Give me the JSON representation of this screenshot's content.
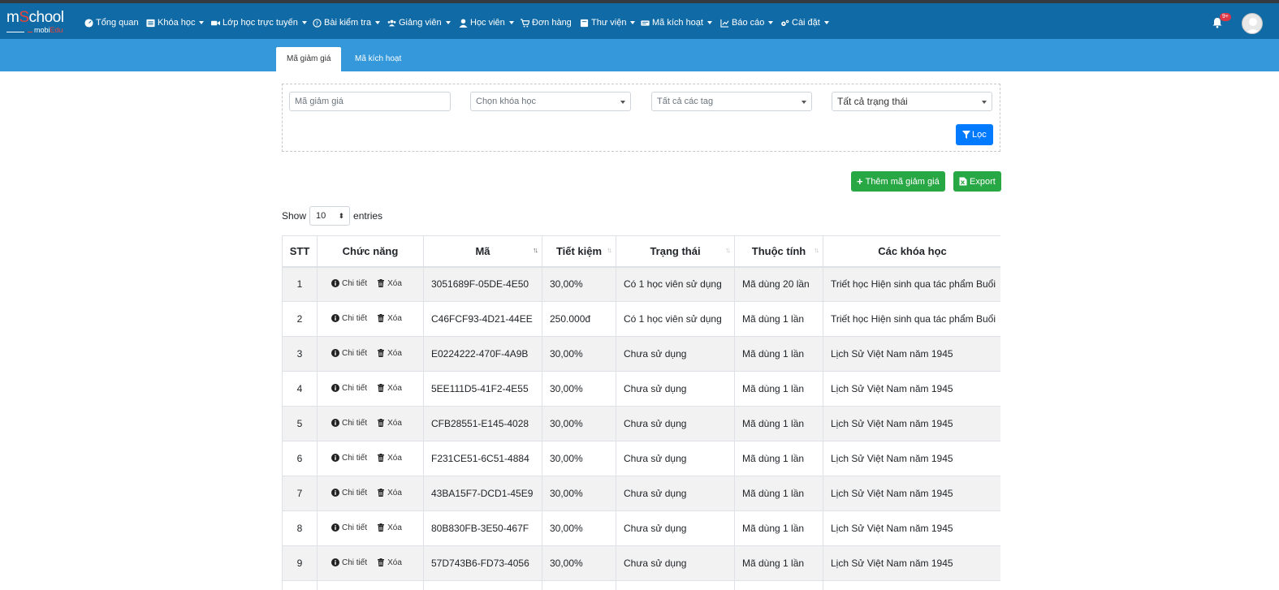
{
  "brand": {
    "logo_main": "m",
    "logo_accent": "S",
    "logo_rest": "chool",
    "logo_sub": "mobi",
    "logo_sub_accent": "Edu"
  },
  "nav": [
    {
      "label": "Tổng quan",
      "icon": "dashboard-icon",
      "caret": false
    },
    {
      "label": "Khóa học",
      "icon": "list-icon",
      "caret": true
    },
    {
      "label": "Lớp học trực tuyến",
      "icon": "video-icon",
      "caret": true
    },
    {
      "label": "Bài kiểm tra",
      "icon": "question-icon",
      "caret": true
    },
    {
      "label": "Giảng viên",
      "icon": "users-icon",
      "caret": true
    },
    {
      "label": "Học viên",
      "icon": "user-icon",
      "caret": true
    },
    {
      "label": "Đơn hàng",
      "icon": "cart-icon",
      "caret": false
    },
    {
      "label": "Thư viện",
      "icon": "book-icon",
      "caret": true
    },
    {
      "label": "Mã kích hoạt",
      "icon": "ticket-icon",
      "caret": true
    },
    {
      "label": "Báo cáo",
      "icon": "chart-icon",
      "caret": true
    },
    {
      "label": "Cài đặt",
      "icon": "cogs-icon",
      "caret": true
    }
  ],
  "notifications": {
    "badge": "9+"
  },
  "tabs": [
    {
      "label": "Mã giảm giá",
      "active": true
    },
    {
      "label": "Mã kích hoạt",
      "active": false
    }
  ],
  "filter": {
    "code_placeholder": "Mã giảm giá",
    "course_select": "Chọn khóa học",
    "tag_select": "Tất cả các tag",
    "status_select": "Tất cả trạng thái",
    "filter_button": "Lọc"
  },
  "actions": {
    "add_label": "Thêm mã giảm giá",
    "export_label": "Export"
  },
  "length": {
    "show": "Show",
    "value": "10",
    "entries": "entries"
  },
  "table": {
    "headers": [
      "STT",
      "Chức năng",
      "Mã",
      "Tiết kiệm",
      "Trạng thái",
      "Thuộc tính",
      "Các khóa học"
    ],
    "detail_label": "Chi tiết",
    "delete_label": "Xóa",
    "rows": [
      {
        "stt": "1",
        "code": "3051689F-05DE-4E50",
        "saving": "30,00%",
        "status": "Có 1 học viên sử dụng",
        "attribute": "Mã dùng 20 lần",
        "courses": "Triết học Hiện sinh qua tác phẩm Buổi"
      },
      {
        "stt": "2",
        "code": "C46FCF93-4D21-44EE",
        "saving": "250.000đ",
        "status": "Có 1 học viên sử dụng",
        "attribute": "Mã dùng 1 lần",
        "courses": "Triết học Hiện sinh qua tác phẩm Buổi"
      },
      {
        "stt": "3",
        "code": "E0224222-470F-4A9B",
        "saving": "30,00%",
        "status": "Chưa sử dụng",
        "attribute": "Mã dùng 1 lần",
        "courses": "Lịch Sử Việt Nam năm 1945"
      },
      {
        "stt": "4",
        "code": "5EE111D5-41F2-4E55",
        "saving": "30,00%",
        "status": "Chưa sử dụng",
        "attribute": "Mã dùng 1 lần",
        "courses": "Lịch Sử Việt Nam năm 1945"
      },
      {
        "stt": "5",
        "code": "CFB28551-E145-4028",
        "saving": "30,00%",
        "status": "Chưa sử dụng",
        "attribute": "Mã dùng 1 lần",
        "courses": "Lịch Sử Việt Nam năm 1945"
      },
      {
        "stt": "6",
        "code": "F231CE51-6C51-4884",
        "saving": "30,00%",
        "status": "Chưa sử dụng",
        "attribute": "Mã dùng 1 lần",
        "courses": "Lịch Sử Việt Nam năm 1945"
      },
      {
        "stt": "7",
        "code": "43BA15F7-DCD1-45E9",
        "saving": "30,00%",
        "status": "Chưa sử dụng",
        "attribute": "Mã dùng 1 lần",
        "courses": "Lịch Sử Việt Nam năm 1945"
      },
      {
        "stt": "8",
        "code": "80B830FB-3E50-467F",
        "saving": "30,00%",
        "status": "Chưa sử dụng",
        "attribute": "Mã dùng 1 lần",
        "courses": "Lịch Sử Việt Nam năm 1945"
      },
      {
        "stt": "9",
        "code": "57D743B6-FD73-4056",
        "saving": "30,00%",
        "status": "Chưa sử dụng",
        "attribute": "Mã dùng 1 lần",
        "courses": "Lịch Sử Việt Nam năm 1945"
      },
      {
        "stt": "",
        "code": "",
        "saving": "",
        "status": "",
        "attribute": "",
        "courses": ""
      }
    ]
  },
  "colors": {
    "navbar": "#0f6aa5",
    "subbar": "#3498db",
    "primary": "#007bff",
    "success": "#28a745"
  }
}
